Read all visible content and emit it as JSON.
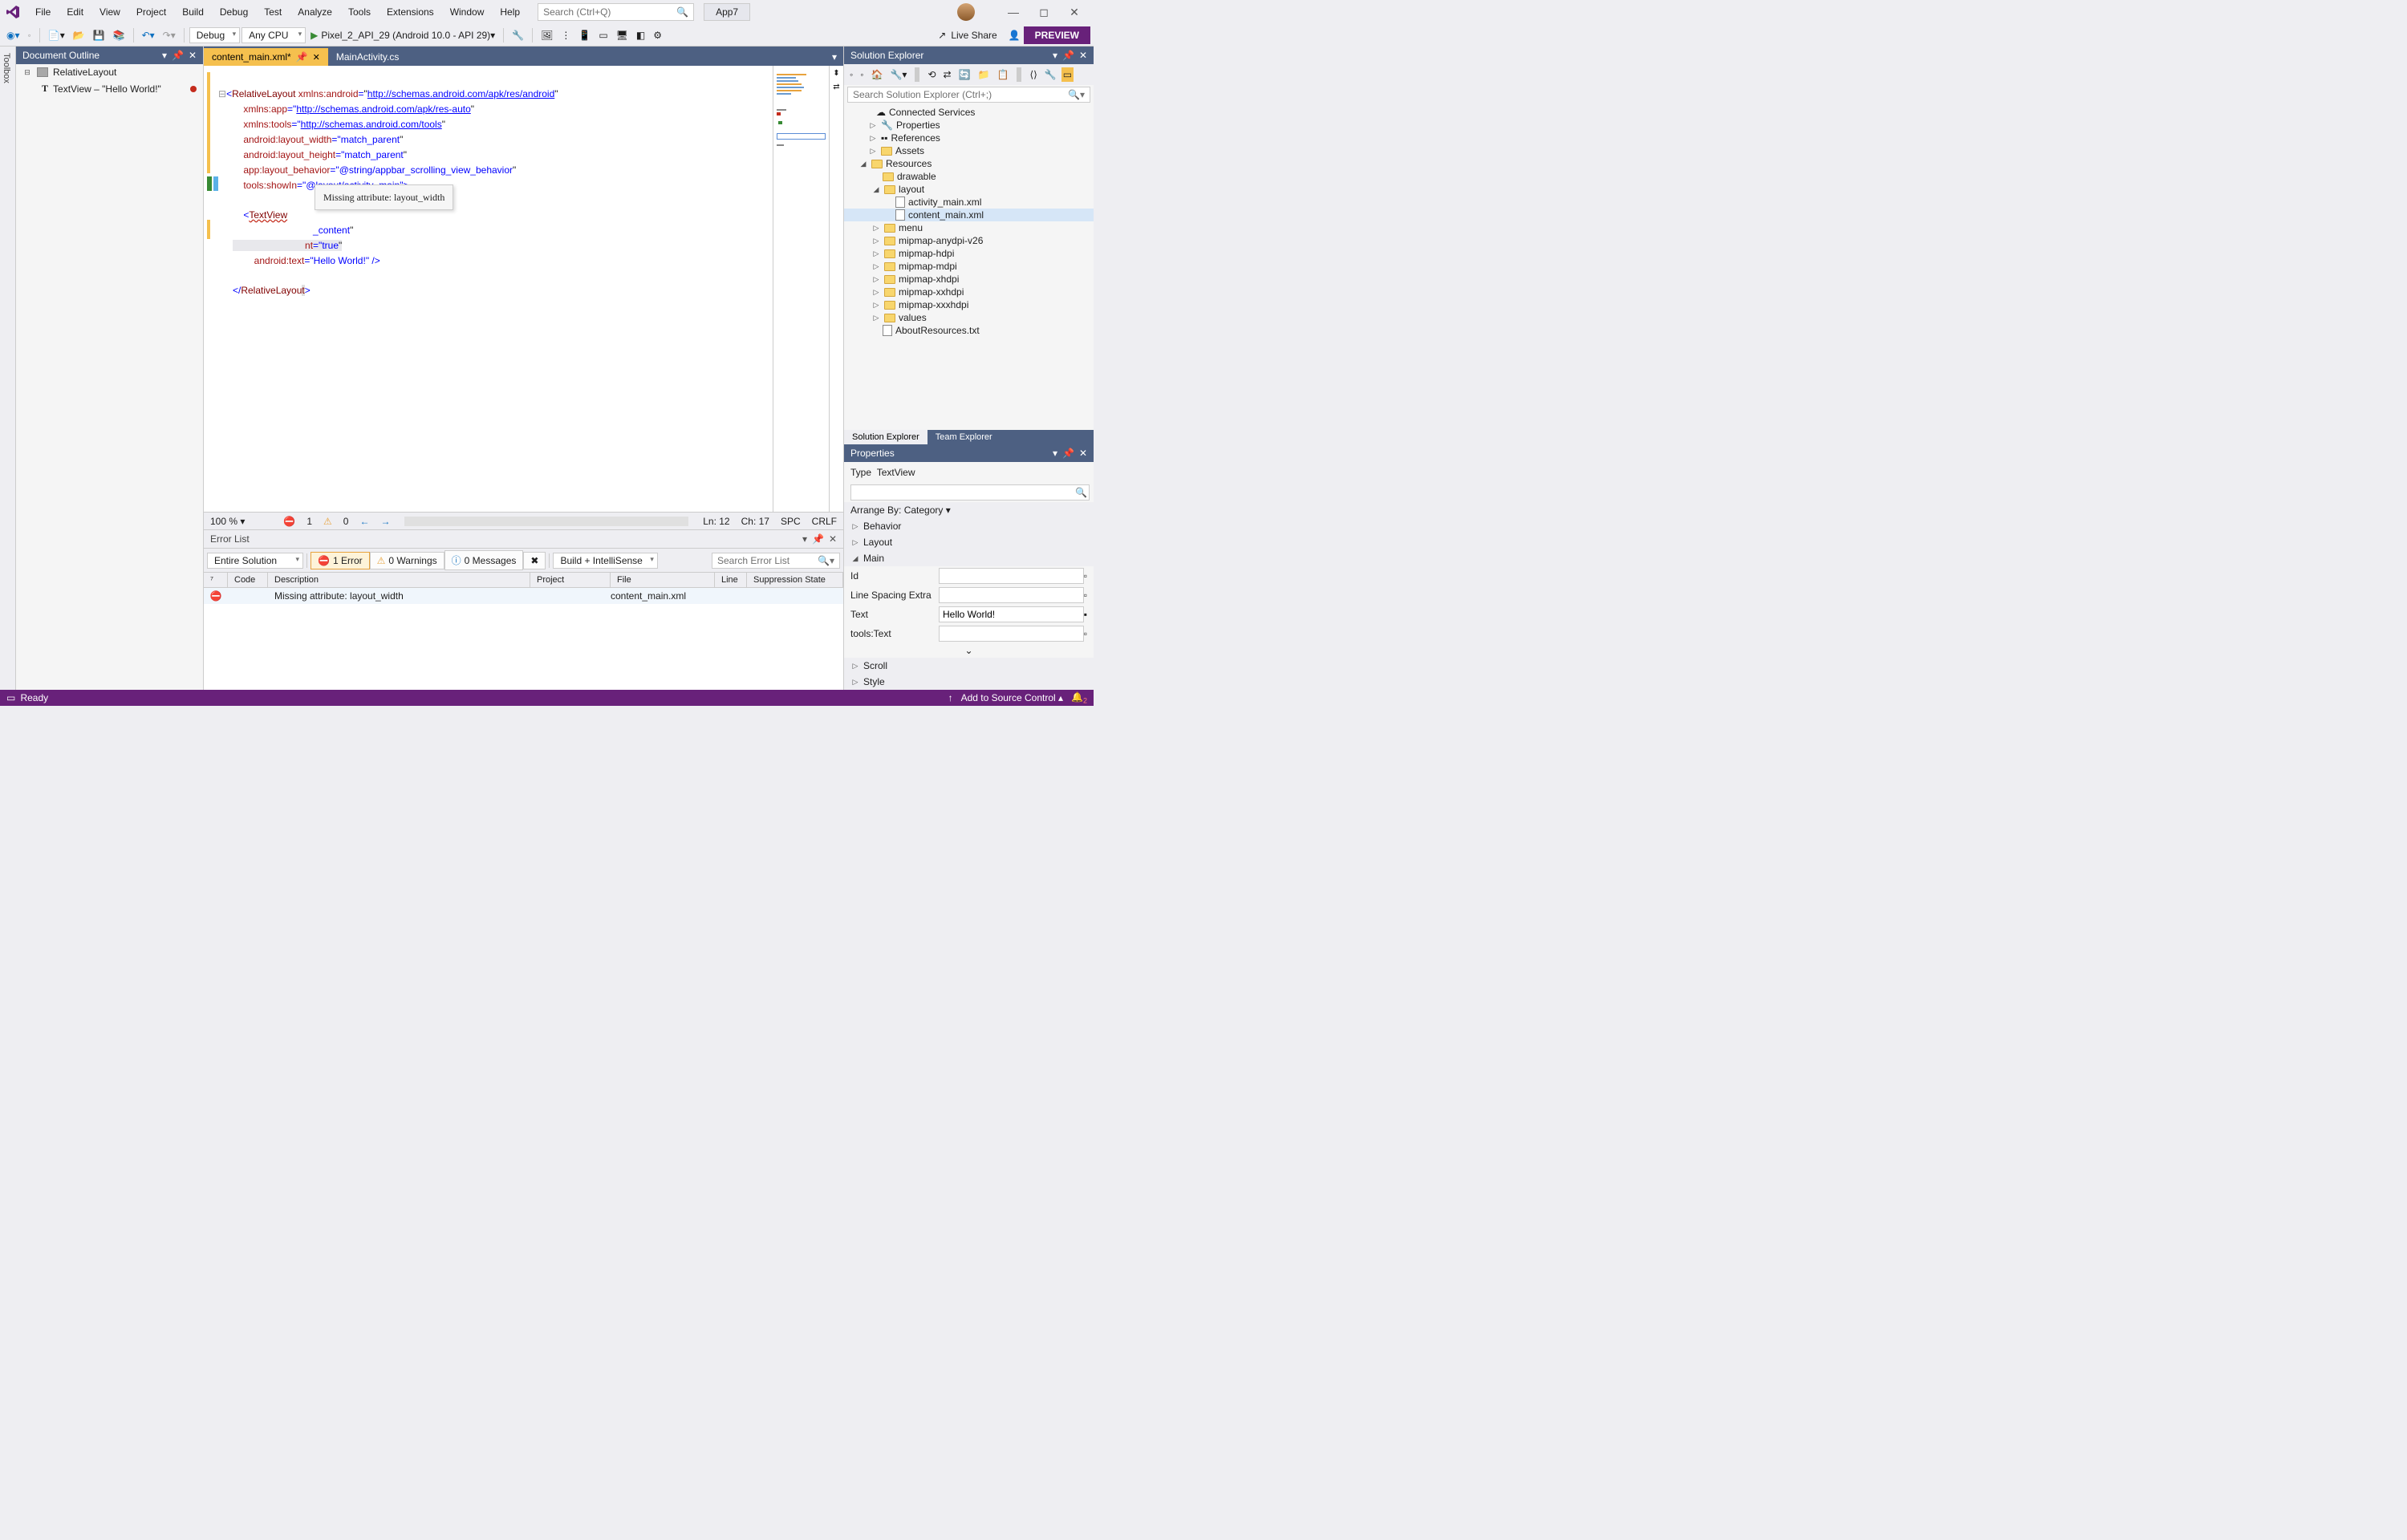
{
  "menu": {
    "file": "File",
    "edit": "Edit",
    "view": "View",
    "project": "Project",
    "build": "Build",
    "debug": "Debug",
    "test": "Test",
    "analyze": "Analyze",
    "tools": "Tools",
    "extensions": "Extensions",
    "window": "Window",
    "help": "Help"
  },
  "search_placeholder": "Search (Ctrl+Q)",
  "app_name": "App7",
  "toolbar": {
    "config": "Debug",
    "platform": "Any CPU",
    "target": "Pixel_2_API_29 (Android 10.0 - API 29)",
    "live_share": "Live Share",
    "preview": "PREVIEW"
  },
  "toolbox_label": "Toolbox",
  "outline": {
    "title": "Document Outline",
    "root": "RelativeLayout",
    "child": "TextView  –  \"Hello World!\""
  },
  "tabs": {
    "active": "content_main.xml*",
    "other": "MainActivity.cs"
  },
  "tooltip": "Missing attribute: layout_width",
  "code": {
    "l1a": "<",
    "l1b": "RelativeLayout",
    "l1c": " xmlns:android",
    "l1d": "=",
    "l1e": "\"",
    "l1f": "http://schemas.android.com/apk/res/android",
    "l1g": "\"",
    "l2a": "    xmlns:app",
    "l2b": "=\"",
    "l2c": "http://schemas.android.com/apk/res-auto",
    "l2d": "\"",
    "l3a": "    xmlns:tools",
    "l3b": "=\"",
    "l3c": "http://schemas.android.com/tools",
    "l3d": "\"",
    "l4a": "    android:layout_width",
    "l4b": "=\"",
    "l4c": "match_parent",
    "l4d": "\"",
    "l5a": "    android:layout_height",
    "l5b": "=\"",
    "l5c": "match_parent",
    "l5d": "\"",
    "l6a": "    app:layout_behavior",
    "l6b": "=\"",
    "l6c": "@string/appbar_scrolling_view_behavior",
    "l6d": "\"",
    "l7a": "    tools:showIn",
    "l7b": "=\"",
    "l7c": "@layout/activity_main",
    "l7d": "\">",
    "l9a": "    <",
    "l9b": "TextView",
    "l11a": "                              ",
    "l11b": "_content",
    "l11c": "\"",
    "l12a": "                           ",
    "l12b": "nt",
    "l12c": "=\"",
    "l12d": "true",
    "l12e": "\"",
    "l13a": "        android:text",
    "l13b": "=\"",
    "l13c": "Hello World!",
    "l13d": "\" />",
    "l15a": "</",
    "l15b": "RelativeLayou",
    "l15c": "t",
    "l15d": ">"
  },
  "editor_status": {
    "zoom": "100 %",
    "errors": "1",
    "warnings": "0",
    "ln": "Ln: 12",
    "ch": "Ch: 17",
    "spc": "SPC",
    "crlf": "CRLF"
  },
  "error_list": {
    "title": "Error List",
    "scope": "Entire Solution",
    "err": "1 Error",
    "warn": "0 Warnings",
    "msg": "0 Messages",
    "build": "Build + IntelliSense",
    "search_ph": "Search Error List",
    "cols": {
      "code": "Code",
      "desc": "Description",
      "proj": "Project",
      "file": "File",
      "line": "Line",
      "supp": "Suppression State"
    },
    "row": {
      "desc": "Missing attribute: layout_width",
      "file": "content_main.xml"
    }
  },
  "solution": {
    "title": "Solution Explorer",
    "search_ph": "Search Solution Explorer (Ctrl+;)",
    "nodes": {
      "connected": "Connected Services",
      "props": "Properties",
      "refs": "References",
      "assets": "Assets",
      "resources": "Resources",
      "drawable": "drawable",
      "layout": "layout",
      "activity": "activity_main.xml",
      "content": "content_main.xml",
      "menu_n": "menu",
      "mip1": "mipmap-anydpi-v26",
      "mip2": "mipmap-hdpi",
      "mip3": "mipmap-mdpi",
      "mip4": "mipmap-xhdpi",
      "mip5": "mipmap-xxhdpi",
      "mip6": "mipmap-xxxhdpi",
      "values": "values",
      "about": "AboutResources.txt"
    },
    "tabs": {
      "sol": "Solution Explorer",
      "team": "Team Explorer"
    }
  },
  "properties": {
    "title": "Properties",
    "type_label": "Type",
    "type_val": "TextView",
    "arrange": "Arrange By: Category ▾",
    "cats": {
      "behavior": "Behavior",
      "layout": "Layout",
      "main": "Main",
      "scroll": "Scroll",
      "style": "Style"
    },
    "props": {
      "id": "Id",
      "lse": "Line Spacing Extra",
      "text": "Text",
      "text_val": "Hello World!",
      "ttext": "tools:Text"
    }
  },
  "status": {
    "ready": "Ready",
    "src": "Add to Source Control"
  }
}
